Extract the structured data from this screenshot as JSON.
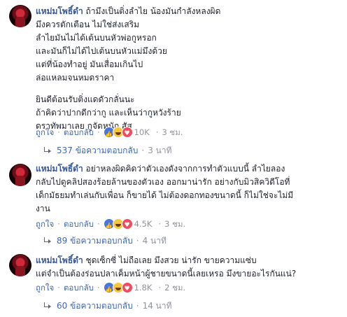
{
  "comments": [
    {
      "author": "แหม่มโพธิ์ดำ",
      "lines": [
        "ถ้ามึงเป็นติ่งลำไย น้องมันกำลังหลงผิด",
        "มึงควรตักเตือน ไม่ใช่ส่งเสริม",
        "ลำไยมันไม่ได้เต้นบนหัวพ่อกูหรอก",
        "และมันก็ไม่ได้ไปเต้นบนหัวแม่มึงด้วย",
        "แต่ที่น้องทำอยู่ มันเสื่อมเกินไป",
        "ล่อแหลมจนหมดราคา"
      ],
      "lines2": [
        "ยินดีต้อนรับติ่งแดดัวกลั่นนะ",
        "ถ้าคิดว่าปากดีกว่ากู และเห็นว่ากูหวังร้าย",
        "ดราทัพมาเลย กูจัดหนัก สัส"
      ],
      "like": "ถูกใจ",
      "reply": "ตอบกลับ",
      "reactions": [
        "like-icon",
        "haha-icon",
        "love-icon"
      ],
      "reaction_count": "10K",
      "time": "3 ชม.",
      "reply_count": "537 ข้อความตอบกลับ",
      "reply_time": "3 นาที"
    },
    {
      "author": "แหม่มโพธิ์ดำ",
      "lines": [
        "อย่าหลงผิดคิดว่าตัวเองดังจากการทำตัวแบบนี้ ลำไยลอง",
        "กลับไปดูคลิปสองร้อยล้านของตัวเอง ออกมาน่ารัก อย่างกับมิวสิควิดีโอที่",
        "เด็กมัธยมทำเล่นกับเพื่อน ก็ขายได้ ไม่ต้องดอกทองขนาดนี้ ก็ไม่ใช่จะไม่มี",
        "งาน"
      ],
      "like": "ถูกใจ",
      "reply": "ตอบกลับ",
      "reactions": [
        "like-icon",
        "haha-icon",
        "love-icon"
      ],
      "reaction_count": "4.5K",
      "time": "3 ชม.",
      "reply_count": "89 ข้อความตอบกลับ",
      "reply_time": "4 นาที"
    },
    {
      "author": "แหม่มโพธิ์ดำ",
      "lines": [
        "ชุดเซ็กซี่ ไม่ถือเลย มึงสวย น่ารัก ขายความแซ่บ",
        "แต่จำเป็นต้องร่อนปลาเค็มหน้าผู้ชายขนาดนี้เลยเหรอ มึงขายอะไรกันแน่?"
      ],
      "like": "ถูกใจ",
      "reply": "ตอบกลับ",
      "reactions": [
        "like-icon",
        "haha-icon",
        "love-icon"
      ],
      "reaction_count": "1.8K",
      "time": "2 ชม.",
      "reply_count": "60 ข้อความตอบกลับ",
      "reply_time": "14 นาที"
    }
  ],
  "colors": {
    "author": "#365899",
    "link": "#4267b2",
    "meta": "#90949c",
    "text": "#1d2129"
  }
}
